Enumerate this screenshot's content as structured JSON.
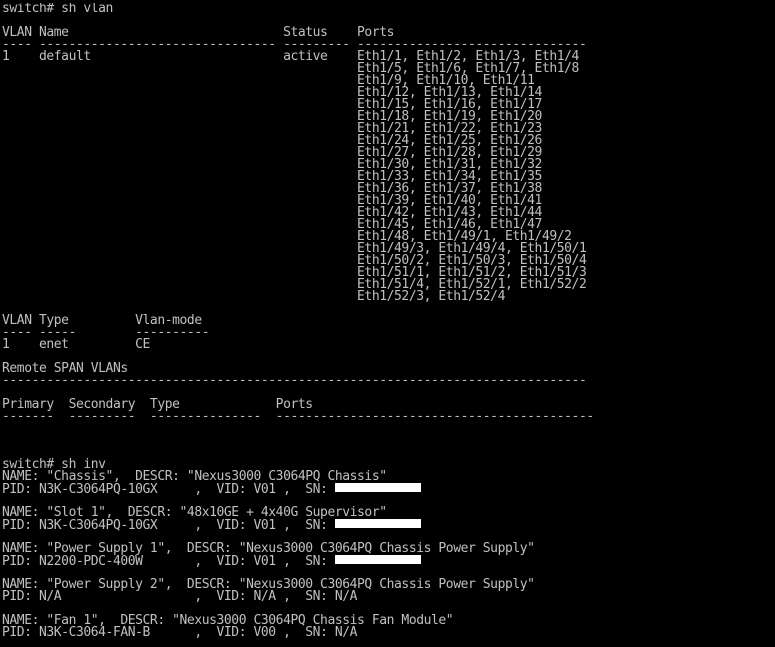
{
  "terminal": {
    "lines": [
      "switch# sh vlan",
      "",
      "VLAN Name                             Status    Ports",
      "---- -------------------------------- --------- -------------------------------",
      "1    default                          active    Eth1/1, Eth1/2, Eth1/3, Eth1/4",
      "                                                Eth1/5, Eth1/6, Eth1/7, Eth1/8",
      "                                                Eth1/9, Eth1/10, Eth1/11",
      "                                                Eth1/12, Eth1/13, Eth1/14",
      "                                                Eth1/15, Eth1/16, Eth1/17",
      "                                                Eth1/18, Eth1/19, Eth1/20",
      "                                                Eth1/21, Eth1/22, Eth1/23",
      "                                                Eth1/24, Eth1/25, Eth1/26",
      "                                                Eth1/27, Eth1/28, Eth1/29",
      "                                                Eth1/30, Eth1/31, Eth1/32",
      "                                                Eth1/33, Eth1/34, Eth1/35",
      "                                                Eth1/36, Eth1/37, Eth1/38",
      "                                                Eth1/39, Eth1/40, Eth1/41",
      "                                                Eth1/42, Eth1/43, Eth1/44",
      "                                                Eth1/45, Eth1/46, Eth1/47",
      "                                                Eth1/48, Eth1/49/1, Eth1/49/2",
      "                                                Eth1/49/3, Eth1/49/4, Eth1/50/1",
      "                                                Eth1/50/2, Eth1/50/3, Eth1/50/4",
      "                                                Eth1/51/1, Eth1/51/2, Eth1/51/3",
      "                                                Eth1/51/4, Eth1/52/1, Eth1/52/2",
      "                                                Eth1/52/3, Eth1/52/4",
      "",
      "VLAN Type         Vlan-mode",
      "---- -----        ----------",
      "1    enet         CE",
      "",
      "Remote SPAN VLANs",
      "-------------------------------------------------------------------------------",
      "",
      "Primary  Secondary  Type             Ports",
      "-------  ---------  ---------------  -------------------------------------------",
      "",
      "",
      "",
      "switch# sh inv",
      "NAME: \"Chassis\",  DESCR: \"Nexus3000 C3064PQ Chassis\"",
      "PID: N3K-C3064PQ-10GX     ,  VID: V01 ,  SN: ",
      "",
      "NAME: \"Slot 1\",  DESCR: \"48x10GE + 4x40G Supervisor\"",
      "PID: N3K-C3064PQ-10GX     ,  VID: V01 ,  SN: ",
      "",
      "NAME: \"Power Supply 1\",  DESCR: \"Nexus3000 C3064PQ Chassis Power Supply\"",
      "PID: N2200-PDC-400W       ,  VID: V01 ,  SN: ",
      "",
      "NAME: \"Power Supply 2\",  DESCR: \"Nexus3000 C3064PQ Chassis Power Supply\"",
      "PID: N/A                  ,  VID: N/A ,  SN: N/A",
      "",
      "NAME: \"Fan 1\",  DESCR: \"Nexus3000 C3064PQ Chassis Fan Module\"",
      "PID: N3K-C3064-FAN-B      ,  VID: V00 ,  SN: N/A"
    ],
    "colors": {
      "background": "#000000",
      "foreground": "#c0c0c0",
      "redaction": "#ffffff"
    }
  }
}
